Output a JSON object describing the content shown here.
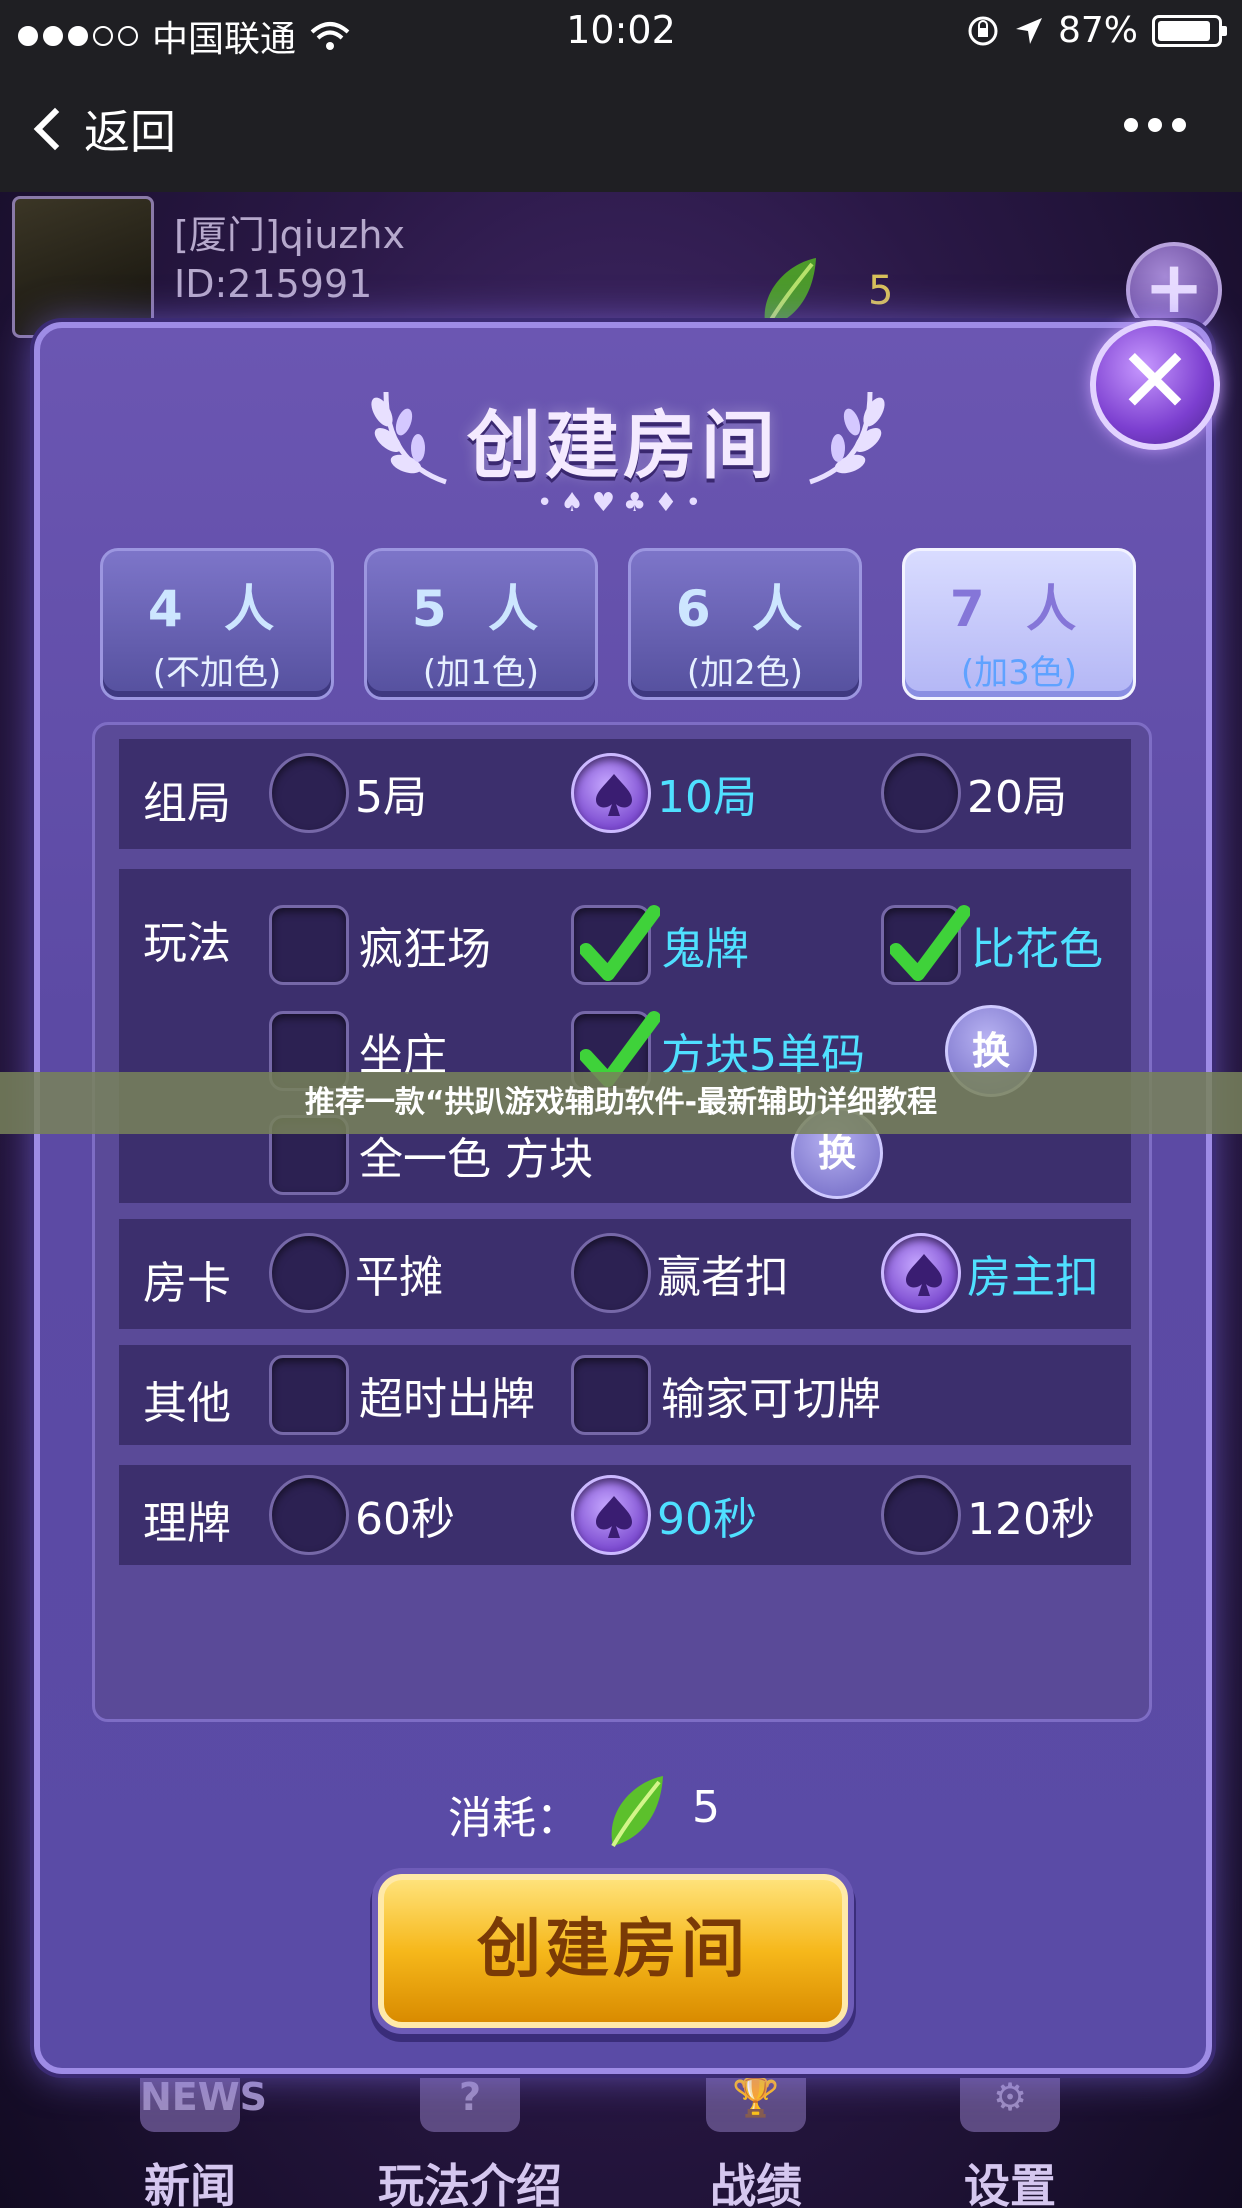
{
  "status_bar": {
    "carrier": "中国联通",
    "time": "10:02",
    "battery": "87%"
  },
  "nav": {
    "back_label": "返回"
  },
  "hud": {
    "player_name": "[厦门]qiuzhx",
    "player_id": "ID:215991",
    "currency_count": "5"
  },
  "dialog": {
    "title": "创建房间",
    "suits": "•♠♥♣♦•",
    "close_label": "✕",
    "tabs": [
      {
        "players": "4 人",
        "colors": "(不加色)"
      },
      {
        "players": "5 人",
        "colors": "(加1色)"
      },
      {
        "players": "6 人",
        "colors": "(加2色)"
      },
      {
        "players": "7 人",
        "colors": "(加3色)",
        "active": true
      }
    ],
    "rounds": {
      "label": "组局",
      "options": [
        "5局",
        "10局",
        "20局"
      ],
      "selected": "10局"
    },
    "gameplay": {
      "label": "玩法",
      "options": [
        "疯狂场",
        "鬼牌",
        "比花色",
        "坐庄",
        "方块5单码",
        "全一色 方块"
      ],
      "checked": [
        "鬼牌",
        "比花色",
        "方块5单码"
      ],
      "swap_label": "换"
    },
    "room_card": {
      "label": "房卡",
      "options": [
        "平摊",
        "赢者扣",
        "房主扣"
      ],
      "selected": "房主扣"
    },
    "other": {
      "label": "其他",
      "options": [
        "超时出牌",
        "输家可切牌"
      ]
    },
    "arrange": {
      "label": "理牌",
      "options": [
        "60秒",
        "90秒",
        "120秒"
      ],
      "selected": "90秒"
    },
    "cost_label": "消耗：",
    "cost_amount": "5",
    "create_button": "创建房间"
  },
  "bottom_nav": [
    {
      "label": "新闻",
      "icon": "NEWS"
    },
    {
      "label": "玩法介绍",
      "icon": "?"
    },
    {
      "label": "战绩",
      "icon": "trophy-icon"
    },
    {
      "label": "设置",
      "icon": "gear-icon"
    }
  ],
  "banner": "推荐一款“拱趴游戏辅助软件-最新辅助详细教程"
}
